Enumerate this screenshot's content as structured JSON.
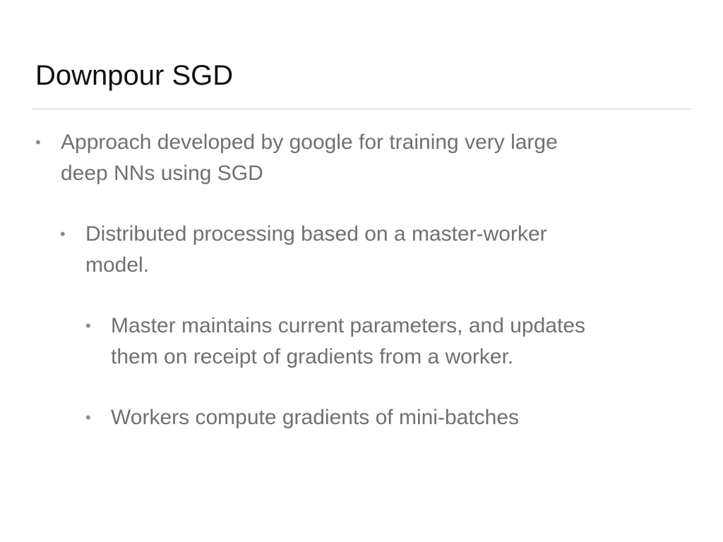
{
  "slide": {
    "title": "Downpour SGD",
    "bullets": [
      {
        "level": 1,
        "marker": "•",
        "lines": [
          "Approach developed by google for training very large",
          "deep NNs using SGD"
        ]
      },
      {
        "level": 2,
        "marker": "•",
        "lines": [
          "Distributed processing based on a master-worker",
          "model."
        ]
      },
      {
        "level": 3,
        "marker": "•",
        "lines": [
          "Master maintains current parameters, and updates",
          "them on receipt of gradients from a worker."
        ]
      },
      {
        "level": 3,
        "marker": "•",
        "lines": [
          "Workers compute gradients of mini-batches"
        ]
      }
    ]
  },
  "colors": {
    "title": "#111111",
    "body": "#707070",
    "rule": "#c9c9c9",
    "background": "#ffffff"
  }
}
